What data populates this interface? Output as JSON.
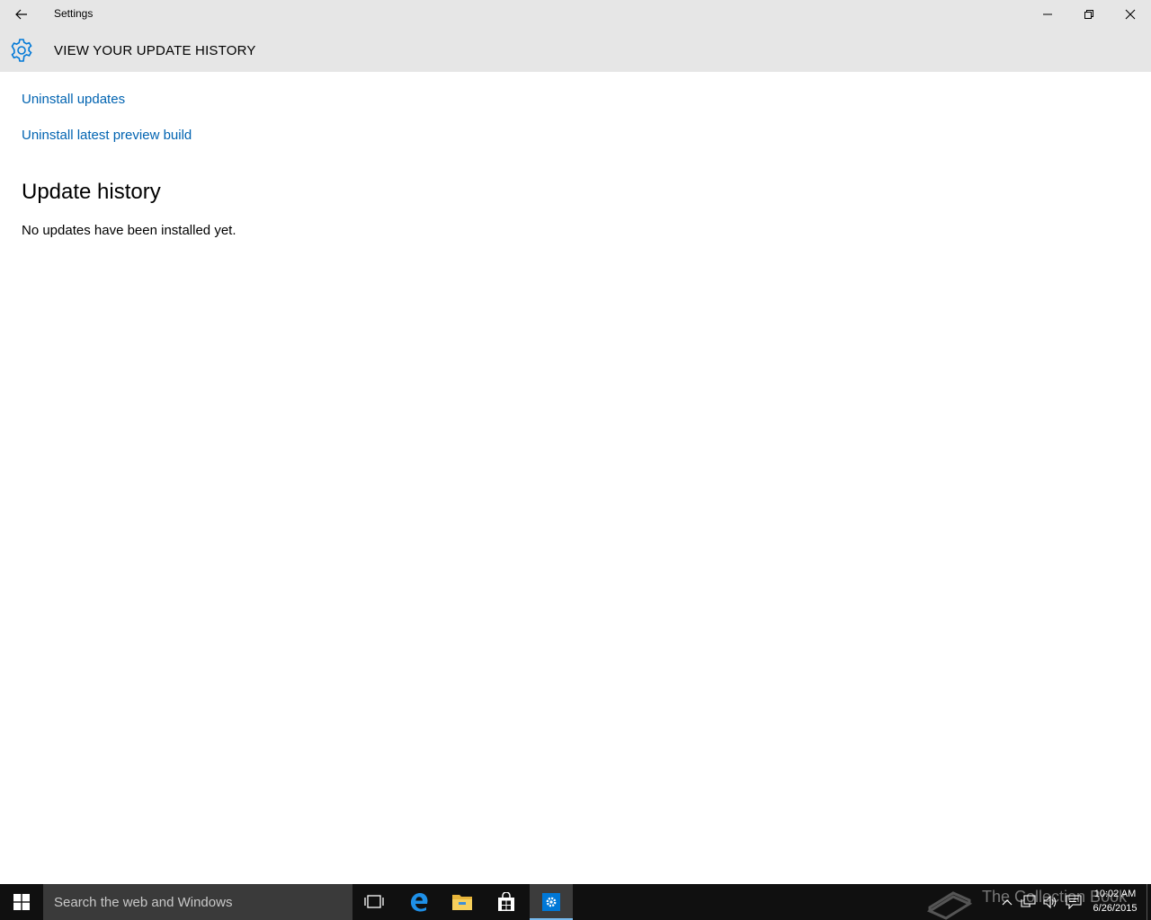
{
  "window": {
    "title": "Settings"
  },
  "header": {
    "title": "VIEW YOUR UPDATE HISTORY",
    "icon": "gear-icon"
  },
  "links": {
    "uninstall_updates": "Uninstall updates",
    "uninstall_preview": "Uninstall latest preview build"
  },
  "history": {
    "heading": "Update history",
    "status": "No updates have been installed yet."
  },
  "taskbar": {
    "search_placeholder": "Search the web and Windows",
    "watermark": "The Collection Book",
    "clock_time": "10:02 AM",
    "clock_date": "6/26/2015"
  },
  "colors": {
    "accent": "#0078d7",
    "link": "#0063b1",
    "titlebar": "#e6e6e6",
    "taskbar": "#101010"
  }
}
